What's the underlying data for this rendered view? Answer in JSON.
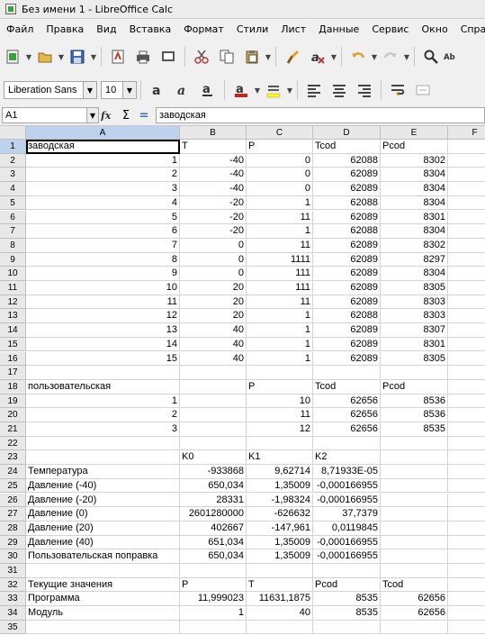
{
  "window": {
    "title": "Без имени 1 - LibreOffice Calc"
  },
  "menu": [
    {
      "label": "Файл",
      "key": "Ф",
      "rest": "айл"
    },
    {
      "label": "Правка",
      "key": "П",
      "rest": "равка"
    },
    {
      "label": "Вид",
      "key": "В",
      "rest": "ид"
    },
    {
      "label": "Вставка",
      "key": "В",
      "rest": "ставка"
    },
    {
      "label": "Формат",
      "key": "м",
      "pre": "Фор",
      "rest": "ат"
    },
    {
      "label": "Стили",
      "key": "",
      "pre": "Стили",
      "rest": ""
    },
    {
      "label": "Лист",
      "key": "",
      "pre": "Лист",
      "rest": ""
    },
    {
      "label": "Данные",
      "key": "Д",
      "rest": "анные"
    },
    {
      "label": "Сервис",
      "key": "С",
      "rest": "ервис"
    },
    {
      "label": "Окно",
      "key": "О",
      "rest": "кно"
    },
    {
      "label": "Справка",
      "key": "С",
      "rest": "правка"
    }
  ],
  "format_toolbar": {
    "font_name": "Liberation Sans",
    "font_size": "10"
  },
  "formula_bar": {
    "cell_ref": "A1",
    "content": "заводская",
    "sum_symbol": "Σ",
    "eq_symbol": "="
  },
  "columns": [
    "A",
    "B",
    "C",
    "D",
    "E",
    "F"
  ],
  "selected_column": "A",
  "selected_row": 1,
  "rows": [
    {
      "n": "1",
      "cells": [
        "заводская",
        "T",
        "P",
        "Tcod",
        "Pcod"
      ]
    },
    {
      "n": "2",
      "cells": [
        "1",
        "-40",
        "0",
        "62088",
        "8302"
      ]
    },
    {
      "n": "3",
      "cells": [
        "2",
        "-40",
        "0",
        "62089",
        "8304"
      ]
    },
    {
      "n": "4",
      "cells": [
        "3",
        "-40",
        "0",
        "62089",
        "8304"
      ]
    },
    {
      "n": "5",
      "cells": [
        "4",
        "-20",
        "1",
        "62088",
        "8304"
      ]
    },
    {
      "n": "6",
      "cells": [
        "5",
        "-20",
        "11",
        "62089",
        "8301"
      ]
    },
    {
      "n": "7",
      "cells": [
        "6",
        "-20",
        "1",
        "62088",
        "8304"
      ]
    },
    {
      "n": "8",
      "cells": [
        "7",
        "0",
        "11",
        "62089",
        "8302"
      ]
    },
    {
      "n": "9",
      "cells": [
        "8",
        "0",
        "1111",
        "62089",
        "8297"
      ]
    },
    {
      "n": "10",
      "cells": [
        "9",
        "0",
        "111",
        "62089",
        "8304"
      ]
    },
    {
      "n": "11",
      "cells": [
        "10",
        "20",
        "111",
        "62089",
        "8305"
      ]
    },
    {
      "n": "12",
      "cells": [
        "11",
        "20",
        "11",
        "62089",
        "8303"
      ]
    },
    {
      "n": "13",
      "cells": [
        "12",
        "20",
        "1",
        "62088",
        "8303"
      ]
    },
    {
      "n": "14",
      "cells": [
        "13",
        "40",
        "1",
        "62089",
        "8307"
      ]
    },
    {
      "n": "15",
      "cells": [
        "14",
        "40",
        "1",
        "62089",
        "8301"
      ]
    },
    {
      "n": "16",
      "cells": [
        "15",
        "40",
        "1",
        "62089",
        "8305"
      ]
    },
    {
      "n": "17",
      "cells": [
        "",
        "",
        "",
        "",
        ""
      ]
    },
    {
      "n": "18",
      "cells": [
        "пользовательская",
        "",
        "P",
        "Tcod",
        "Pcod"
      ]
    },
    {
      "n": "19",
      "cells": [
        "1",
        "",
        "10",
        "62656",
        "8536"
      ]
    },
    {
      "n": "20",
      "cells": [
        "2",
        "",
        "11",
        "62656",
        "8536"
      ]
    },
    {
      "n": "21",
      "cells": [
        "3",
        "",
        "12",
        "62656",
        "8535"
      ]
    },
    {
      "n": "22",
      "cells": [
        "",
        "",
        "",
        "",
        ""
      ]
    },
    {
      "n": "23",
      "cells": [
        "",
        "K0",
        "K1",
        "K2",
        ""
      ]
    },
    {
      "n": "24",
      "cells": [
        "Температура",
        "-933868",
        "9,62714",
        "8,71933E-05",
        ""
      ]
    },
    {
      "n": "25",
      "cells": [
        "Давление (-40)",
        "650,034",
        "1,35009",
        "-0,000166955",
        ""
      ]
    },
    {
      "n": "26",
      "cells": [
        "Давление (-20)",
        "28331",
        "-1,98324",
        "-0,000166955",
        ""
      ]
    },
    {
      "n": "27",
      "cells": [
        "Давление (0)",
        "2601280000",
        "-626632",
        "37,7379",
        ""
      ]
    },
    {
      "n": "28",
      "cells": [
        "Давление (20)",
        "402667",
        "-147,961",
        "0,0119845",
        ""
      ]
    },
    {
      "n": "29",
      "cells": [
        "Давление (40)",
        "651,034",
        "1,35009",
        "-0,000166955",
        ""
      ]
    },
    {
      "n": "30",
      "cells": [
        "Пользовательская поправка",
        "650,034",
        "1,35009",
        "-0,000166955",
        ""
      ]
    },
    {
      "n": "31",
      "cells": [
        "",
        "",
        "",
        "",
        ""
      ]
    },
    {
      "n": "32",
      "cells": [
        "Текущие значения",
        "P",
        "T",
        "Pcod",
        "Tcod"
      ]
    },
    {
      "n": "33",
      "cells": [
        "Программа",
        "11,999023",
        "11631,1875",
        "8535",
        "62656"
      ]
    },
    {
      "n": "34",
      "cells": [
        "Модуль",
        "1",
        "40",
        "8535",
        "62656"
      ]
    },
    {
      "n": "35",
      "cells": [
        "",
        "",
        "",
        "",
        ""
      ]
    }
  ]
}
